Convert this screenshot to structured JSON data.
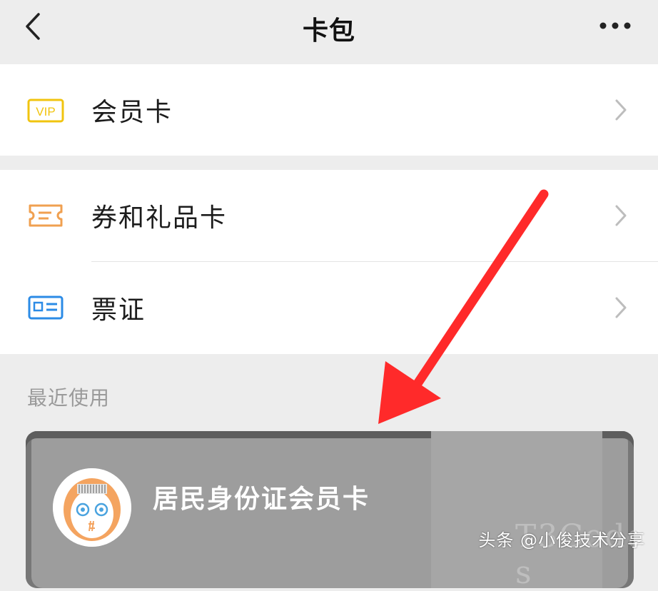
{
  "header": {
    "title": "卡包",
    "back_icon": "chevron-left-icon",
    "more_icon": "more-dots-icon"
  },
  "menu": {
    "items": [
      {
        "label": "会员卡",
        "icon": "vip-icon",
        "icon_text": "VIP",
        "icon_color": "#f1c40f"
      },
      {
        "label": "券和礼品卡",
        "icon": "ticket-icon",
        "icon_color": "#f0a050"
      },
      {
        "label": "票证",
        "icon": "id-card-icon",
        "icon_color": "#2b8be6"
      }
    ]
  },
  "recent": {
    "section_label": "最近使用",
    "card_title": "居民身份证会员卡",
    "card_color": "#9d9d9d"
  },
  "watermark": {
    "text": "头条 @小俊技术分享",
    "faint_text": "T3Code s"
  },
  "annotation": {
    "arrow_color": "#ff2a2a"
  }
}
